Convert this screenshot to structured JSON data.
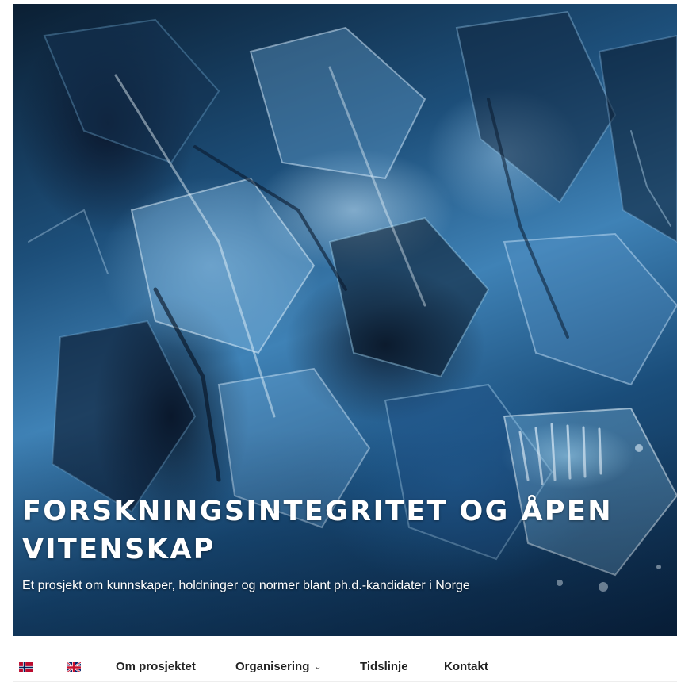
{
  "header": {
    "site_title": "FORSKNINGSINTEGRITET OG ÅPEN VITENSKAP",
    "tagline": "Et prosjekt om kunnskaper, holdninger og normer blant ph.d.-kandidater i Norge",
    "hero_image": "blue-ice-crystal-image"
  },
  "nav": {
    "languages": [
      {
        "icon": "norwegian-flag-icon"
      },
      {
        "icon": "british-flag-icon"
      }
    ],
    "items": [
      {
        "label": "Om prosjektet"
      },
      {
        "label": "Organisering",
        "icon": "chevron-down-icon"
      },
      {
        "label": "Tidslinje"
      },
      {
        "label": "Kontakt"
      }
    ]
  },
  "colors": {
    "hero_blue": "#3f82b6",
    "title_text": "#ffffff",
    "nav_text": "#222222",
    "nav_background": "#ffffff"
  }
}
